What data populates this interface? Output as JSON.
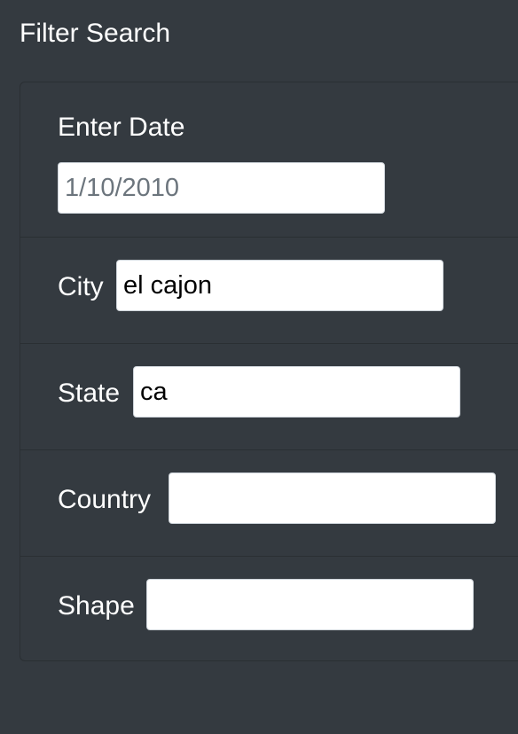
{
  "header": {
    "title": "Filter Search"
  },
  "filters": {
    "date": {
      "label": "Enter Date",
      "placeholder": "1/10/2010",
      "value": ""
    },
    "city": {
      "label": "City",
      "value": "el cajon"
    },
    "state": {
      "label": "State",
      "value": "ca"
    },
    "country": {
      "label": "Country",
      "value": ""
    },
    "shape": {
      "label": "Shape",
      "value": ""
    }
  },
  "colors": {
    "background": "#343a40",
    "border": "#2a2f33",
    "text": "#ffffff",
    "input_background": "#ffffff",
    "placeholder": "#6c757d"
  }
}
